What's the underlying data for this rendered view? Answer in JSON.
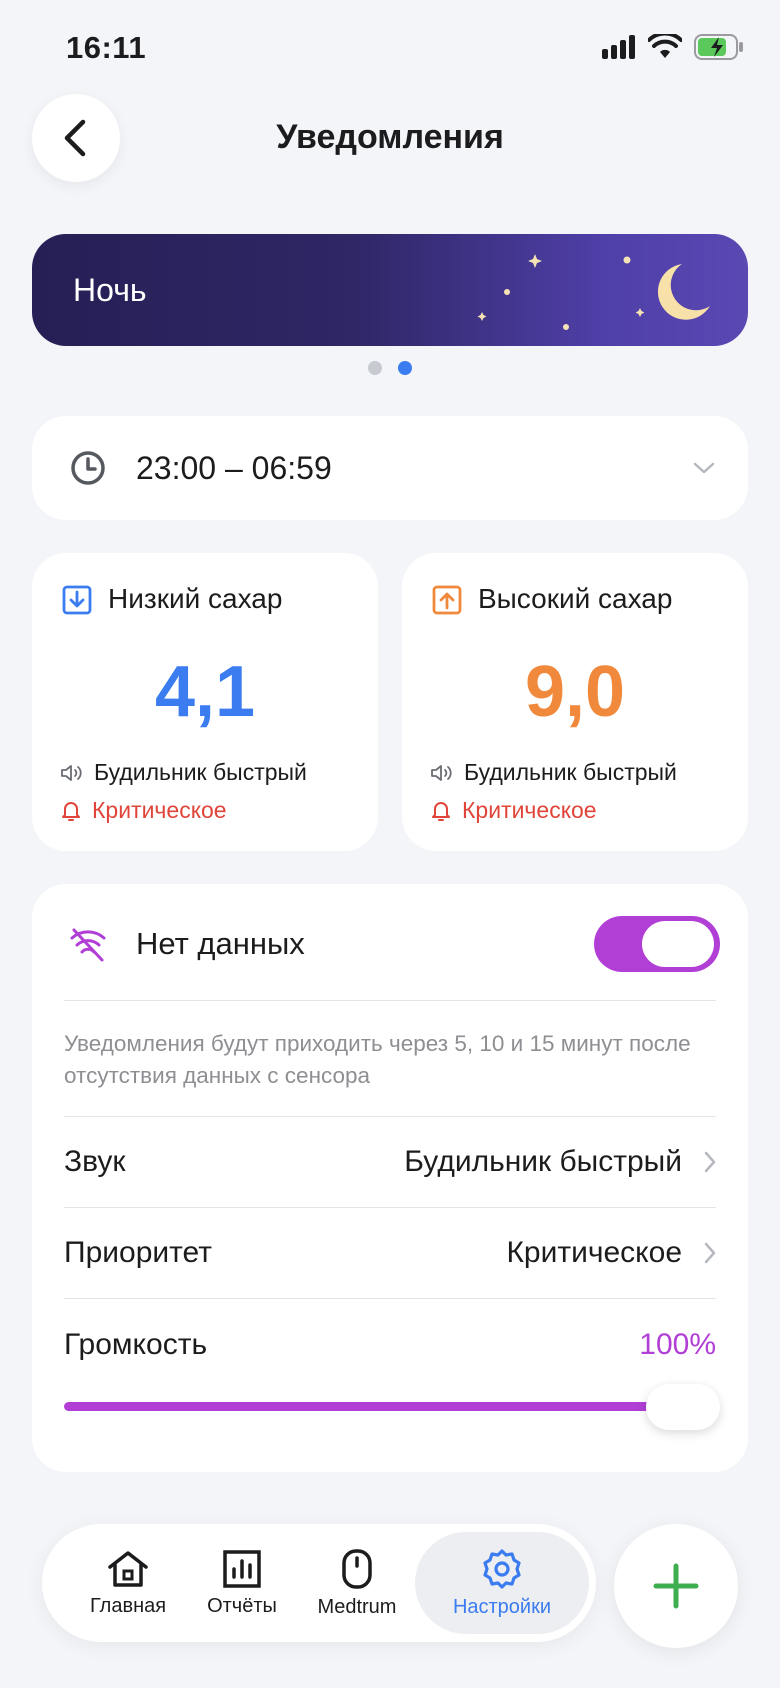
{
  "status_bar": {
    "time": "16:11"
  },
  "header": {
    "title": "Уведомления"
  },
  "banner": {
    "label": "Ночь",
    "pages": 2,
    "active_page": 2
  },
  "time_range": {
    "value": "23:00 – 06:59"
  },
  "low_sugar": {
    "title": "Низкий сахар",
    "value": "4,1",
    "sound": "Будильник быстрый",
    "priority": "Критическое",
    "color": "#3b7cf0"
  },
  "high_sugar": {
    "title": "Высокий сахар",
    "value": "9,0",
    "sound": "Будильник быстрый",
    "priority": "Критическое",
    "color": "#f0893b"
  },
  "no_data": {
    "title": "Нет данных",
    "enabled": true,
    "description": "Уведомления будут приходить через 5, 10 и 15 минут после отсутствия данных с сенсора",
    "sound_label": "Звук",
    "sound_value": "Будильник быстрый",
    "priority_label": "Приоритет",
    "priority_value": "Критическое",
    "volume_label": "Громкость",
    "volume_value": "100%",
    "volume_fraction": 1.0,
    "accent": "#b13fd6"
  },
  "tabbar": {
    "items": [
      {
        "label": "Главная",
        "icon": "home-icon"
      },
      {
        "label": "Отчёты",
        "icon": "chart-icon"
      },
      {
        "label": "Medtrum",
        "icon": "device-icon"
      },
      {
        "label": "Настройки",
        "icon": "gear-icon",
        "active": true
      }
    ],
    "active_color": "#3b7cf0"
  },
  "fab": {
    "icon": "plus-icon",
    "color": "#3fae4f"
  },
  "priority_color": "#e0453a"
}
